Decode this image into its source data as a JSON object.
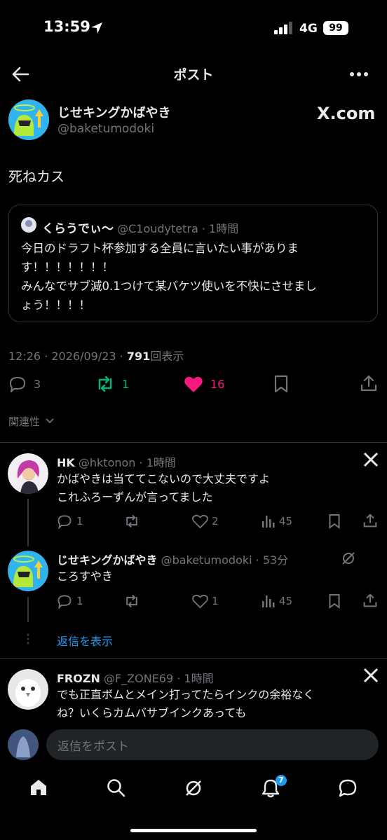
{
  "status": {
    "time": "13:59",
    "network": "4G",
    "battery": "99"
  },
  "header": {
    "title": "ポスト"
  },
  "post": {
    "author_name": "じせキングかばやき",
    "author_handle": "@baketumodoki",
    "source_logo": "X.com",
    "text": "死ねカス",
    "quote": {
      "author_name": "くらうでぃ〜",
      "author_handle": "@C1oudytetra",
      "time": "1時間",
      "line1": "今日のドラフト杯参加する全員に言いたい事がありま",
      "line2": "す！！！！！！！",
      "line3": "みんなでサブ減0.1つけて某バケツ使いを不快にさせまし",
      "line4": "ょう！！！！"
    },
    "timestamp": "12:26 · 2026/09/23 · ",
    "views_count": "791",
    "views_label": "回表示",
    "replies": "3",
    "reposts": "1",
    "likes": "16"
  },
  "sort_label": "関連性",
  "replies": [
    {
      "name": "HK",
      "handle": "@hktonon",
      "time": "1時間",
      "line1": "かばやきは当ててこないので大丈夫ですよ",
      "line2": "これふろーずんが言ってました",
      "replies": "1",
      "likes": "2",
      "views": "45"
    },
    {
      "name": "じせキングかばやき",
      "handle": "@baketumodoki",
      "time": "53分",
      "line1": "ころすやき",
      "replies": "1",
      "likes": "1",
      "views": "45"
    },
    {
      "name": "FROZN",
      "handle": "@F_ZONE69",
      "time": "1時間",
      "line1": "でも正直ボムとメイン打ってたらインクの余裕なく",
      "line2": "ね？いくらカムバサブインクあっても"
    }
  ],
  "show_replies_label": "返信を表示",
  "composer": {
    "placeholder": "返信をポスト"
  },
  "nav": {
    "notification_badge": "7"
  },
  "colors": {
    "accent": "#1d9bf0",
    "like": "#f91880",
    "repost": "#00ba7c",
    "muted": "#71767b"
  },
  "icons": [
    "back-arrow-icon",
    "more-icon",
    "x-logo-icon",
    "reply-icon",
    "repost-icon",
    "heart-icon",
    "bookmark-icon",
    "share-icon",
    "views-icon",
    "home-icon",
    "search-icon",
    "grok-icon",
    "bell-icon",
    "messages-icon",
    "chevron-down-icon",
    "verified-icon"
  ]
}
